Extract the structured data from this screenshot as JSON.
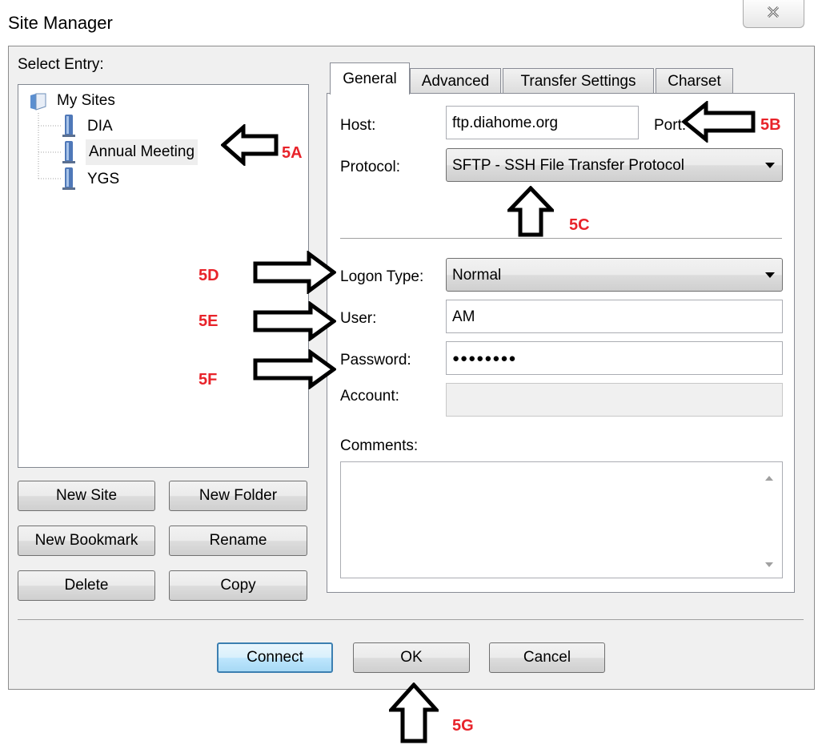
{
  "window": {
    "title": "Site Manager",
    "close_icon": "close-icon"
  },
  "select_entry_label": "Select Entry:",
  "tree": {
    "root": "My Sites",
    "items": [
      "DIA",
      "Annual Meeting",
      "YGS"
    ],
    "selected": "Annual Meeting"
  },
  "left_buttons": {
    "new_site": "New Site",
    "new_folder": "New Folder",
    "new_bookmark": "New Bookmark",
    "rename": "Rename",
    "delete": "Delete",
    "copy": "Copy"
  },
  "tabs": [
    "General",
    "Advanced",
    "Transfer Settings",
    "Charset"
  ],
  "active_tab": "General",
  "general": {
    "host_label": "Host:",
    "host_value": "ftp.diahome.org",
    "port_label": "Port:",
    "protocol_label": "Protocol:",
    "protocol_value": "SFTP - SSH File Transfer Protocol",
    "logon_type_label": "Logon Type:",
    "logon_type_value": "Normal",
    "user_label": "User:",
    "user_value": "AM",
    "password_label": "Password:",
    "password_value": "●●●●●●●●",
    "account_label": "Account:",
    "account_value": "",
    "comments_label": "Comments:",
    "comments_value": ""
  },
  "bottom_buttons": {
    "connect": "Connect",
    "ok": "OK",
    "cancel": "Cancel"
  },
  "annotations": {
    "a": "5A",
    "b": "5B",
    "c": "5C",
    "d": "5D",
    "e": "5E",
    "f": "5F",
    "g": "5G"
  },
  "colors": {
    "annotation": "#e8232a",
    "dialog_bg": "#f0f0f0",
    "default_button_border": "#3c7fb1"
  }
}
